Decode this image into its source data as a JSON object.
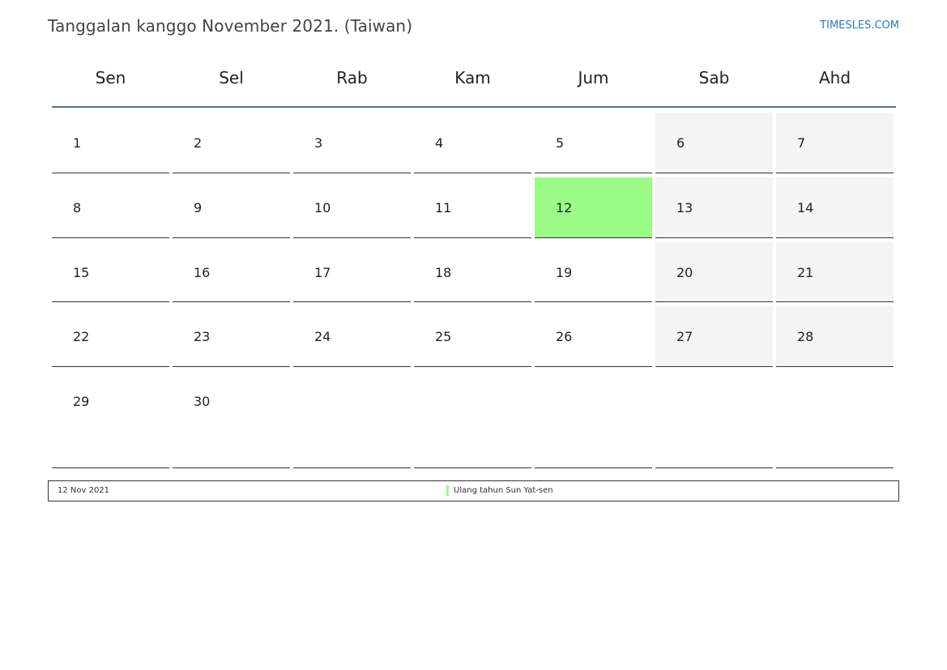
{
  "header": {
    "title": "Tanggalan kanggo November 2021. (Taiwan)",
    "site": "TIMESLES.COM"
  },
  "weekdays": [
    "Sen",
    "Sel",
    "Rab",
    "Kam",
    "Jum",
    "Sab",
    "Ahd"
  ],
  "days": {
    "d1": "1",
    "d2": "2",
    "d3": "3",
    "d4": "4",
    "d5": "5",
    "d6": "6",
    "d7": "7",
    "d8": "8",
    "d9": "9",
    "d10": "10",
    "d11": "11",
    "d12": "12",
    "d13": "13",
    "d14": "14",
    "d15": "15",
    "d16": "16",
    "d17": "17",
    "d18": "18",
    "d19": "19",
    "d20": "20",
    "d21": "21",
    "d22": "22",
    "d23": "23",
    "d24": "24",
    "d25": "25",
    "d26": "26",
    "d27": "27",
    "d28": "28",
    "d29": "29",
    "d30": "30"
  },
  "holiday_highlight_color": "#9bfb87",
  "weekend_color": "#f4f4f4",
  "legend": {
    "date": "12 Nov 2021",
    "name": "Ulang tahun Sun Yat-sen"
  }
}
